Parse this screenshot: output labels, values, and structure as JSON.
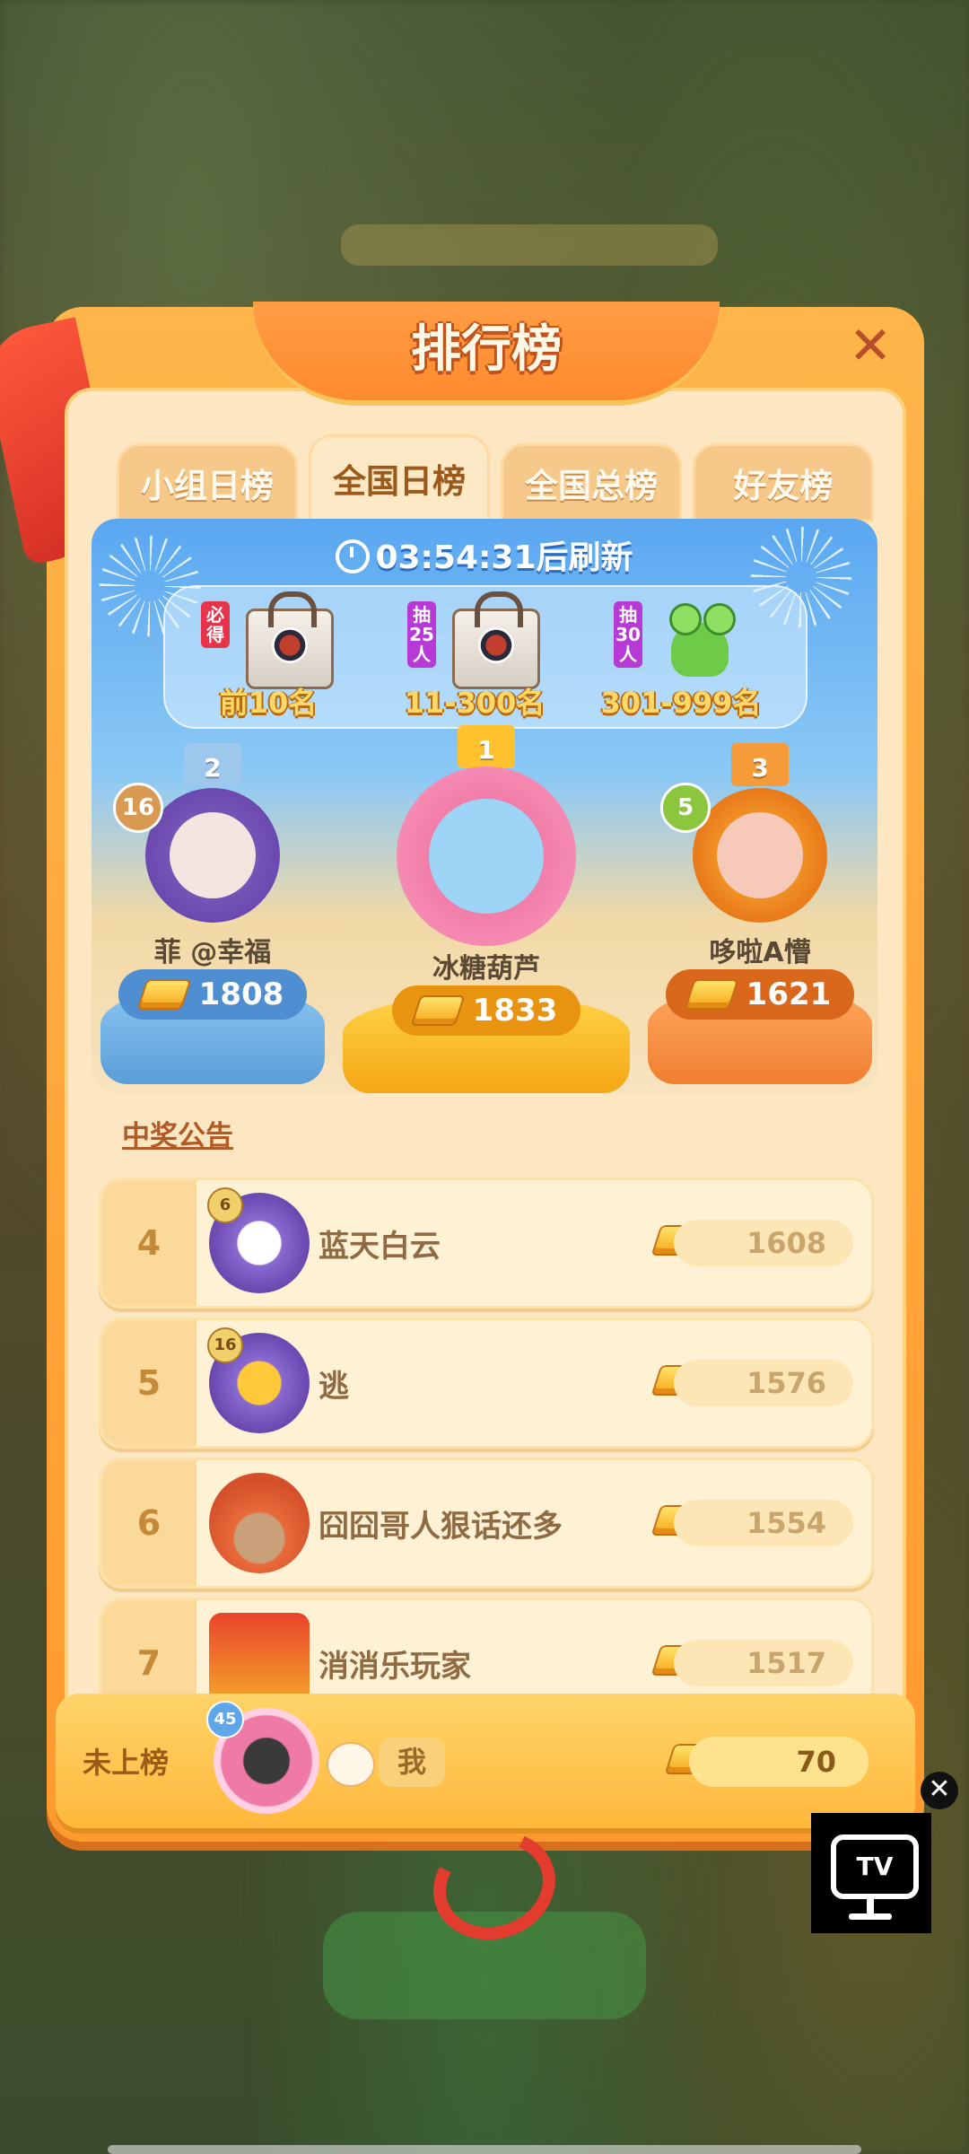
{
  "title": "排行榜",
  "close_symbol": "✕",
  "tabs": [
    {
      "label": "小组日榜",
      "active": false
    },
    {
      "label": "全国日榜",
      "active": true
    },
    {
      "label": "全国总榜",
      "active": false
    },
    {
      "label": "好友榜",
      "active": false
    }
  ],
  "timer": {
    "time": "03:54:31",
    "suffix": "后刷新"
  },
  "rewards": [
    {
      "tag": "必得",
      "label": "前10名",
      "item": "gift-bag-icon"
    },
    {
      "tag": "抽25人",
      "label": "11-300名",
      "item": "gift-bag-icon"
    },
    {
      "tag": "抽30人",
      "label": "301-999名",
      "item": "frog-plush-icon"
    }
  ],
  "podium": [
    {
      "rank": "2",
      "level": "16",
      "name": "菲 @幸福",
      "score": "1808"
    },
    {
      "rank": "1",
      "level": "",
      "name": "冰糖葫芦",
      "score": "1833"
    },
    {
      "rank": "3",
      "level": "5",
      "name": "哆啦A懵",
      "score": "1621"
    }
  ],
  "notice_label": "中奖公告",
  "list": [
    {
      "rank": "4",
      "level": "6",
      "name": "蓝天白云",
      "score": "1608"
    },
    {
      "rank": "5",
      "level": "16",
      "name": "逃",
      "score": "1576"
    },
    {
      "rank": "6",
      "level": "",
      "name": "囧囧哥人狠话还多",
      "score": "1554"
    },
    {
      "rank": "7",
      "level": "",
      "name": "消消乐玩家",
      "score": "1517"
    }
  ],
  "me": {
    "rank_label": "未上榜",
    "level": "45",
    "name": "我",
    "score": "70"
  },
  "overlay": {
    "close_symbol": "✕",
    "tv_label": "TV"
  },
  "colors": {
    "accent": "#ff9a2e",
    "panel": "#fde7c2",
    "sky": "#5aa7f1",
    "gold": "#f6a51a"
  }
}
